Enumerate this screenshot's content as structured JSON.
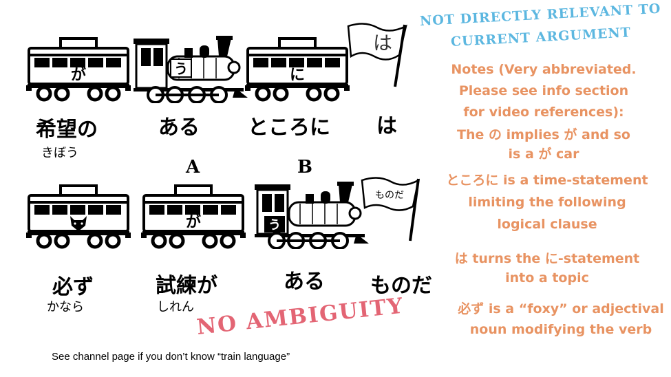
{
  "header_stamp": {
    "line1": "NOT DIRECTLY RELEVANT TO",
    "line2": "CURRENT ARGUMENT"
  },
  "row1": {
    "cars": [
      {
        "kind": "carriage",
        "mark": "が"
      },
      {
        "kind": "locomotive",
        "mark": "う"
      },
      {
        "kind": "carriage",
        "mark": "に"
      },
      {
        "kind": "flag",
        "mark": "は"
      }
    ],
    "labels": [
      "希望の",
      "ある",
      "ところに",
      "は"
    ],
    "furigana": [
      "きぼう"
    ]
  },
  "markers": {
    "a": "A",
    "b": "B"
  },
  "row2": {
    "cars": [
      {
        "kind": "carriage",
        "mark": "fox-icon"
      },
      {
        "kind": "carriage",
        "mark": "が"
      },
      {
        "kind": "locomotive",
        "mark": "う"
      },
      {
        "kind": "flag",
        "mark": "ものだ"
      }
    ],
    "labels": [
      "必ず",
      "試練が",
      "ある",
      "ものだ"
    ],
    "furigana": [
      "かなら",
      "しれん"
    ]
  },
  "notes": {
    "intro": [
      "Notes (Very abbreviated.",
      "Please see info section",
      "for video references):"
    ],
    "n1": [
      "The の implies が and so",
      "is a が car"
    ],
    "n2": [
      "ところに is a time-statement",
      "limiting the following",
      "logical clause"
    ],
    "n3": [
      "は turns the に-statement",
      "into a topic"
    ],
    "n4": [
      "必ず is a “foxy” or adjectival",
      "noun modifying the verb"
    ]
  },
  "stamp": "NO AMBIGUITY",
  "footer": "See channel page if you don’t know “train language”"
}
